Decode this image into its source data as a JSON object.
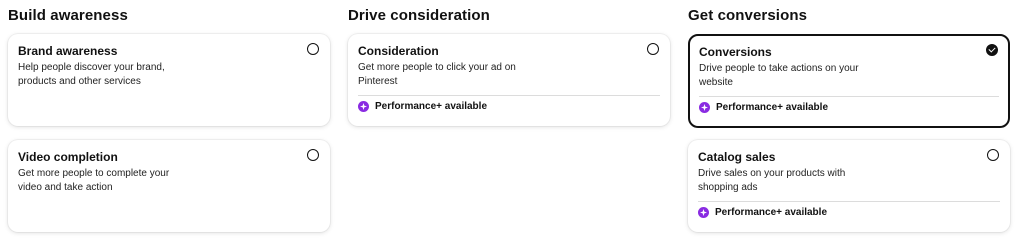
{
  "columns": [
    {
      "title": "Build awareness",
      "cards": [
        {
          "title": "Brand awareness",
          "desc": "Help people discover your brand, products and other services",
          "badge": "",
          "selected": false
        },
        {
          "title": "Video completion",
          "desc": "Get more people to complete your video and take action",
          "badge": "",
          "selected": false
        }
      ]
    },
    {
      "title": "Drive consideration",
      "cards": [
        {
          "title": "Consideration",
          "desc": "Get more people to click your ad on Pinterest",
          "badge": "Performance+ available",
          "selected": false
        }
      ]
    },
    {
      "title": "Get conversions",
      "cards": [
        {
          "title": "Conversions",
          "desc": "Drive people to take actions on your website",
          "badge": "Performance+ available",
          "selected": true
        },
        {
          "title": "Catalog sales",
          "desc": "Drive sales on your products with shopping ads",
          "badge": "Performance+ available",
          "selected": false
        }
      ]
    }
  ],
  "colors": {
    "accent": "#8a2be2",
    "selected_border": "#111111"
  },
  "icons": {
    "badge": "sparkle-icon",
    "radio": "radio-icon",
    "check": "checkmark-icon"
  }
}
